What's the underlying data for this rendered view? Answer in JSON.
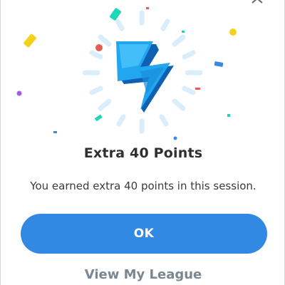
{
  "dialog": {
    "title": "Extra 40 Points",
    "message": "You earned extra 40 points in this session.",
    "ok_label": "OK",
    "league_link_label": "View My League"
  },
  "colors": {
    "primary_button": "#3189e3",
    "link_text": "#7a8790",
    "bolt_front": "#21a6ef",
    "bolt_side": "#0f5fb3",
    "confetti": [
      "#1ed6b8",
      "#f4d21c",
      "#e85c57",
      "#3a8be0",
      "#a45be6"
    ]
  },
  "icons": {
    "close": "close-icon",
    "hero": "lightning-bolt-icon"
  }
}
